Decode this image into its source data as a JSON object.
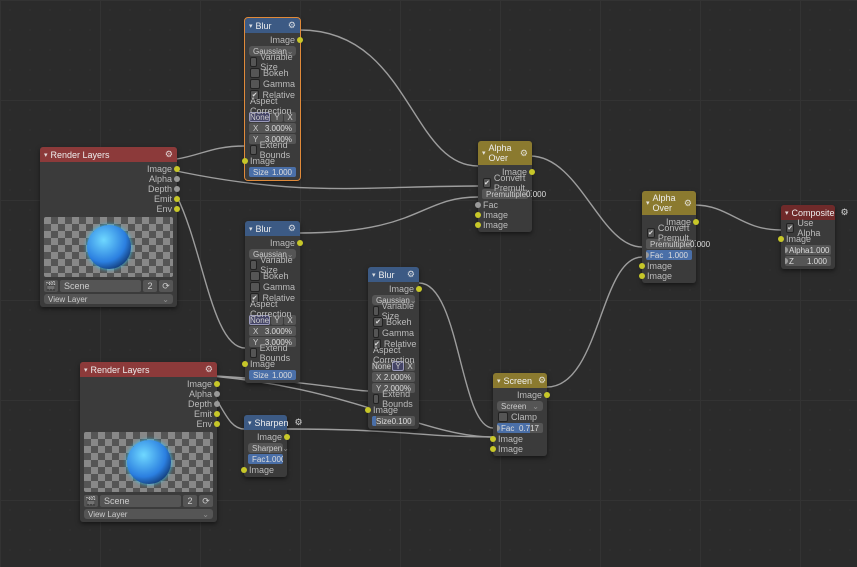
{
  "rl1": {
    "title": "Render Layers",
    "outs": [
      "Image",
      "Alpha",
      "Depth",
      "Emit",
      "Env"
    ],
    "scene": "Scene",
    "scene_num": "2",
    "viewlayer": "View Layer"
  },
  "rl2": {
    "title": "Render Layers",
    "outs": [
      "Image",
      "Alpha",
      "Depth",
      "Emit",
      "Env"
    ],
    "scene": "Scene",
    "scene_num": "2",
    "viewlayer": "View Layer"
  },
  "blur1": {
    "title": "Blur",
    "out": "Image",
    "type": "Gaussian",
    "vs": "Variable Size",
    "bokeh": "Bokeh",
    "gamma": "Gamma",
    "rel": "Relative",
    "aspect": "Aspect Correction",
    "btn_none": "None",
    "btn_y": "Y",
    "btn_x": "X",
    "xl": "X",
    "xv": "3.000%",
    "yl": "Y",
    "yv": "3.000%",
    "eb": "Extend Bounds",
    "in_img": "Image",
    "size_l": "Size",
    "size_v": "1.000"
  },
  "blur2": {
    "title": "Blur",
    "out": "Image",
    "type": "Gaussian",
    "vs": "Variable Size",
    "bokeh": "Bokeh",
    "gamma": "Gamma",
    "rel": "Relative",
    "aspect": "Aspect Correction",
    "btn_none": "None",
    "btn_y": "Y",
    "btn_x": "X",
    "xl": "X",
    "xv": "3.000%",
    "yl": "Y",
    "yv": "3.000%",
    "eb": "Extend Bounds",
    "in_img": "Image",
    "size_l": "Size",
    "size_v": "1.000"
  },
  "blur3": {
    "title": "Blur",
    "out": "Image",
    "type": "Gaussian",
    "vs": "Variable Size",
    "bokeh": "Bokeh",
    "gamma": "Gamma",
    "rel": "Relative",
    "aspect": "Aspect Correction",
    "btn_none": "None",
    "btn_y": "Y",
    "btn_x": "X",
    "xl": "X",
    "xv": "2.000%",
    "yl": "Y",
    "yv": "2.000%",
    "eb": "Extend Bounds",
    "in_img": "Image",
    "size_l": "Size",
    "size_v": "0.100"
  },
  "sharpen": {
    "title": "Sharpen",
    "out": "Image",
    "type": "Sharpen",
    "fac_l": "Fac",
    "fac_v": "1.000",
    "in_img": "Image"
  },
  "ao1": {
    "title": "Alpha Over",
    "out": "Image",
    "cp": "Convert Premult...",
    "pm_l": "Premultiple",
    "pm_v": "0.000",
    "fac": "Fac",
    "img1": "Image",
    "img2": "Image"
  },
  "ao2": {
    "title": "Alpha Over",
    "out": "Image",
    "cp": "Convert Premult...",
    "pm_l": "Premultiple",
    "pm_v": "0.000",
    "fac_l": "Fac",
    "fac_v": "1.000",
    "img1": "Image",
    "img2": "Image"
  },
  "screen": {
    "title": "Screen",
    "out": "Image",
    "mode": "Screen",
    "clamp": "Clamp",
    "fac_l": "Fac",
    "fac_v": "0.717",
    "img1": "Image",
    "img2": "Image"
  },
  "comp": {
    "title": "Composite",
    "ua": "Use Alpha",
    "img": "Image",
    "alpha_l": "Alpha",
    "alpha_v": "1.000",
    "z_l": "Z",
    "z_v": "1.000"
  }
}
